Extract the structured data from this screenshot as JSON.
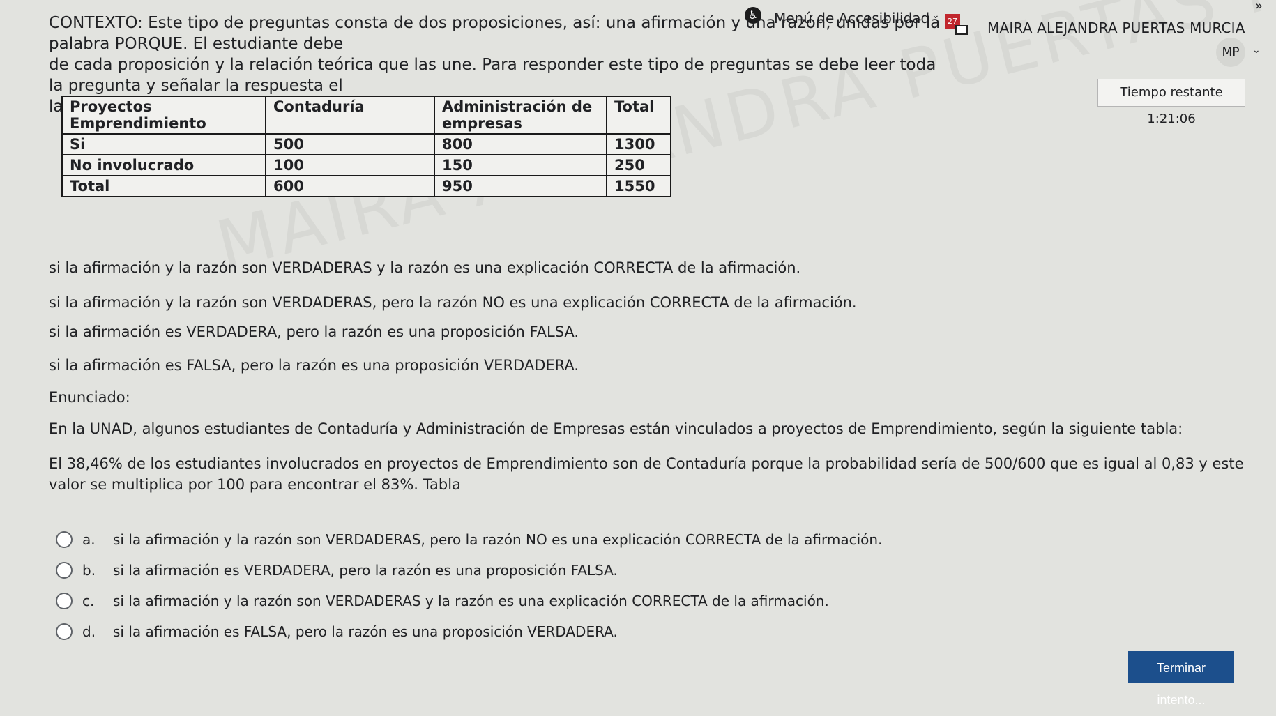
{
  "header": {
    "accessibility_menu": "Menú de Accesibilidad",
    "notification_count": "27",
    "user_name": "MAIRA ALEJANDRA PUERTAS MURCIA",
    "user_initials": "MP"
  },
  "context": {
    "line1": "CONTEXTO: Este tipo de preguntas consta de dos proposiciones, así: una afirmación y una razón, unidas por la palabra PORQUE. El estudiante debe",
    "line2": "de cada proposición y la relación teórica que las une. Para responder este tipo de preguntas se debe leer toda la pregunta y señalar la respuesta el",
    "line3": "las siguientes instrucciones."
  },
  "timer": "Tiempo restante 1:21:06",
  "table": {
    "headers": [
      "Proyectos Emprendimiento",
      "Contaduría",
      "Administración de empresas",
      "Total"
    ],
    "rows": [
      [
        "Si",
        "500",
        "800",
        "1300"
      ],
      [
        "No involucrado",
        "100",
        "150",
        "250"
      ],
      [
        "Total",
        "600",
        "950",
        "1550"
      ]
    ]
  },
  "instructions": [
    "si la afirmación y la razón son VERDADERAS y la razón es una explicación CORRECTA de la afirmación.",
    "si la afirmación y la razón son VERDADERAS, pero la razón NO es una explicación CORRECTA de la afirmación.",
    "si la afirmación es VERDADERA, pero la razón es una proposición FALSA.",
    "si la afirmación es FALSA, pero la razón es una proposición VERDADERA."
  ],
  "enunciado": {
    "label": "Enunciado:",
    "p1": "En la UNAD, algunos estudiantes de Contaduría y Administración de Empresas están vinculados a proyectos de Emprendimiento, según la siguiente tabla:",
    "p2": "El 38,46% de los estudiantes involucrados en proyectos de Emprendimiento son de Contaduría porque la probabilidad sería de 500/600 que es igual al 0,83 y este valor se multiplica por 100 para encontrar el 83%. Tabla"
  },
  "options": [
    {
      "letter": "a.",
      "text": "si la afirmación y la razón son VERDADERAS, pero la razón NO es una explicación CORRECTA de la afirmación."
    },
    {
      "letter": "b.",
      "text": "si la afirmación es VERDADERA, pero la razón es una proposición FALSA."
    },
    {
      "letter": "c.",
      "text": "si la afirmación y la razón son VERDADERAS y la razón es una explicación CORRECTA de la afirmación."
    },
    {
      "letter": "d.",
      "text": "si la afirmación es FALSA, pero la razón es una proposición VERDADERA."
    }
  ],
  "watermark": "MAIRA ALEJANDRA PUERTAS MURCIA",
  "finish_button": "Terminar intento..."
}
